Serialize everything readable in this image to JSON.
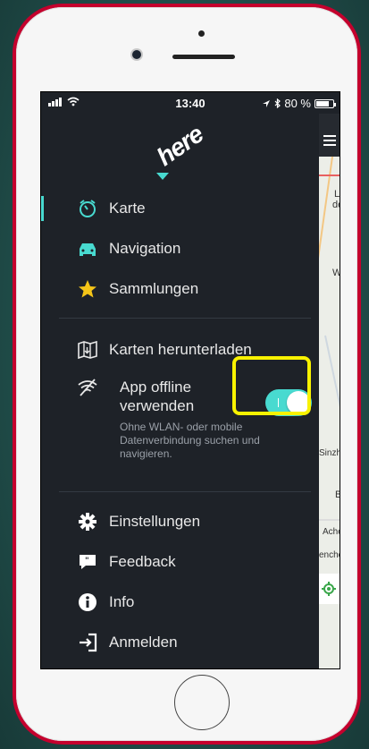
{
  "status_bar": {
    "time": "13:40",
    "battery": "80 %",
    "battery_level": 0.8
  },
  "brand": {
    "logo_text": "here",
    "accent": "#48dad0",
    "highlight": "#f8f200",
    "phone_color": "#c4002d"
  },
  "menu": {
    "primary": [
      {
        "label": "Karte",
        "icon": "stopwatch-icon",
        "active": true
      },
      {
        "label": "Navigation",
        "icon": "car-icon",
        "active": false
      },
      {
        "label": "Sammlungen",
        "icon": "star-icon",
        "active": false
      }
    ],
    "download_label": "Karten herunterladen",
    "offline": {
      "label": "App offline verwenden",
      "description": "Ohne WLAN- oder mobile Datenverbindung suchen und navigieren.",
      "enabled": true
    },
    "secondary": [
      {
        "label": "Einstellungen",
        "icon": "gear-icon"
      },
      {
        "label": "Feedback",
        "icon": "chat-icon"
      },
      {
        "label": "Info",
        "icon": "info-icon"
      },
      {
        "label": "Anmelden",
        "icon": "login-icon"
      }
    ]
  },
  "map": {
    "labels": [
      "La",
      "de",
      "We",
      "Sinzheim",
      "B",
      "Acherr",
      "enchen"
    ]
  }
}
